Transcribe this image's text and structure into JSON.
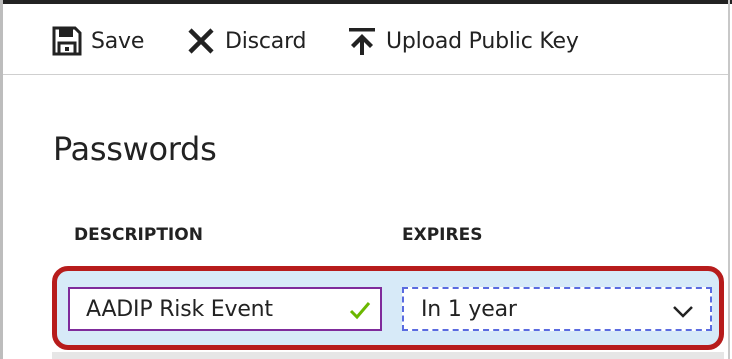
{
  "toolbar": {
    "save_label": "Save",
    "discard_label": "Discard",
    "upload_label": "Upload Public Key",
    "icons": {
      "save": "save-icon",
      "discard": "close-icon",
      "upload": "upload-icon"
    }
  },
  "section": {
    "title": "Passwords"
  },
  "table": {
    "headers": {
      "description": "DESCRIPTION",
      "expires": "EXPIRES"
    },
    "row": {
      "description_value": "AADIP Risk Event",
      "expires_value": "In 1 year"
    }
  },
  "colors": {
    "highlight_border": "#b71c1c",
    "row_background": "#d7eaf8",
    "input_border": "#7f2b9b",
    "select_border": "#5a6be0",
    "valid_check": "#6bb700"
  }
}
